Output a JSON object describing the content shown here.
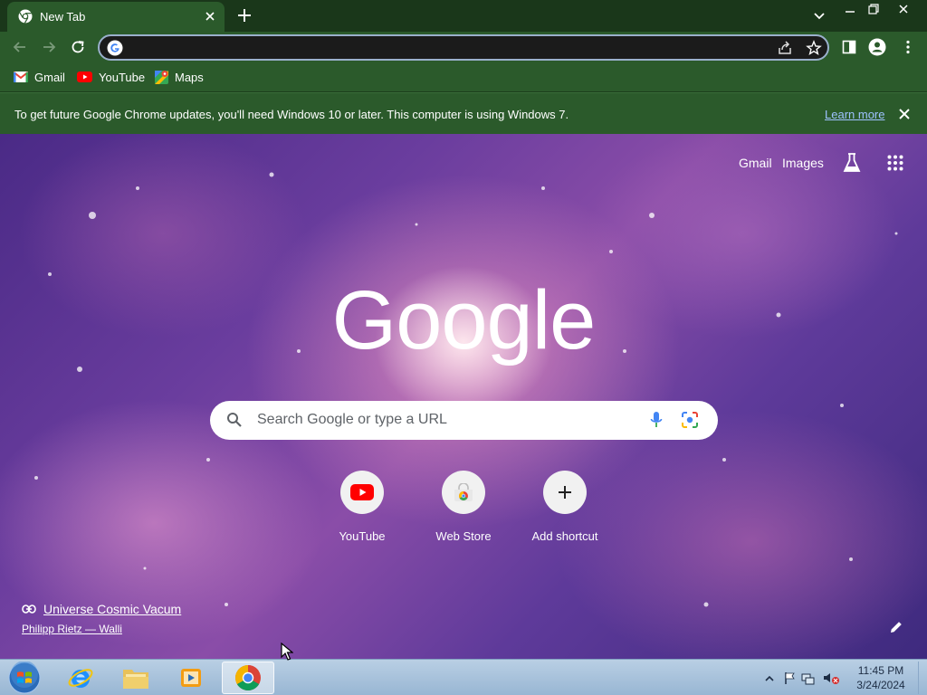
{
  "window": {
    "tab_title": "New Tab",
    "icons": {
      "tab_favicon": "chrome-icon",
      "tab_close": "close-icon",
      "new_tab": "plus-icon",
      "tab_search": "chevron-down-icon",
      "minimize": "minimize-icon",
      "maximize": "restore-icon",
      "close": "close-icon"
    }
  },
  "toolbar": {
    "omnibox_value": "",
    "icons": [
      "back-icon",
      "forward-icon",
      "reload-icon",
      "google-icon",
      "share-icon",
      "star-icon",
      "side-panel-icon",
      "profile-icon",
      "menu-icon"
    ]
  },
  "bookmarks": [
    {
      "label": "Gmail",
      "icon": "gmail-icon"
    },
    {
      "label": "YouTube",
      "icon": "youtube-icon"
    },
    {
      "label": "Maps",
      "icon": "maps-icon"
    }
  ],
  "infobar": {
    "message": "To get future Google Chrome updates, you'll need Windows 10 or later. This computer is using Windows 7.",
    "link": "Learn more"
  },
  "ntp": {
    "top_links": {
      "gmail": "Gmail",
      "images": "Images"
    },
    "logo": "Google",
    "search_placeholder": "Search Google or type a URL",
    "shortcuts": [
      {
        "label": "YouTube",
        "icon": "youtube-icon"
      },
      {
        "label": "Web Store",
        "icon": "webstore-icon"
      },
      {
        "label": "Add shortcut",
        "icon": "plus-icon"
      }
    ],
    "attribution": {
      "title": "Universe Cosmic Vacum",
      "author": "Philipp Rietz — Walli"
    }
  },
  "taskbar": {
    "items": [
      "start-orb-icon",
      "internet-explorer-icon",
      "file-explorer-icon",
      "media-player-icon",
      "chrome-icon"
    ],
    "clock_time": "11:45 PM",
    "clock_date": "3/24/2024"
  },
  "colors": {
    "frame": "#1a371a",
    "toolbar": "#2b5a2b",
    "omnibox_border": "#9ab0cc",
    "link": "#9ec2ff"
  }
}
